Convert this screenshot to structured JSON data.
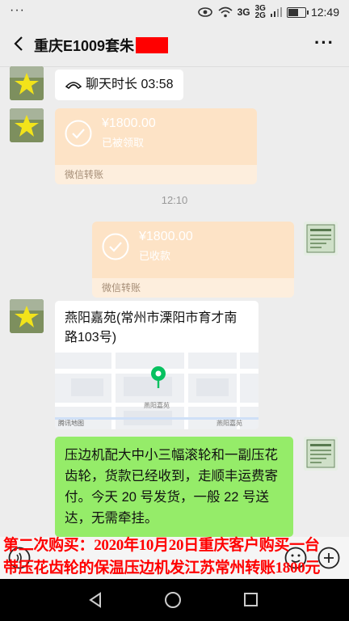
{
  "status_bar": {
    "time": "12:49",
    "net_top": "3G",
    "net_bottom": "2G",
    "net_large": "3G",
    "more": "···",
    "battery_level": 0.6
  },
  "header": {
    "title": "重庆E1009套朱",
    "more": "···"
  },
  "messages": {
    "call": {
      "text": "聊天时长 03:58"
    },
    "transfer1": {
      "amount": "¥1800.00",
      "status": "已被领取",
      "footer": "微信转账"
    },
    "time": "12:10",
    "transfer2": {
      "amount": "¥1800.00",
      "status": "已收款",
      "footer": "微信转账"
    },
    "location": {
      "title": "燕阳嘉苑(常州市溧阳市育才南路103号)",
      "map_labels": [
        "燕阳嘉苑",
        "腾讯地图",
        "燕阳嘉苑"
      ]
    },
    "text": "压边机配大中小三幅滚轮和一副压花齿轮，货款已经收到，走顺丰运费寄付。今天 20 号发货，一般 22 号送达，无需牵挂。"
  },
  "caption": {
    "line1": "第二次购买：2020年10月20日重庆客户购买一台",
    "line2": "带压花齿轮的保温压边机发江苏常州转账1800元"
  },
  "colors": {
    "transfer_bg": "#fde3c6",
    "green_bubble": "#95ec69",
    "caption_red": "#ff0000"
  },
  "icons": [
    "back-arrow-icon",
    "more-icon",
    "phone-icon",
    "check-circle-icon",
    "map-pin-icon",
    "voice-icon",
    "emoji-icon",
    "plus-icon"
  ]
}
